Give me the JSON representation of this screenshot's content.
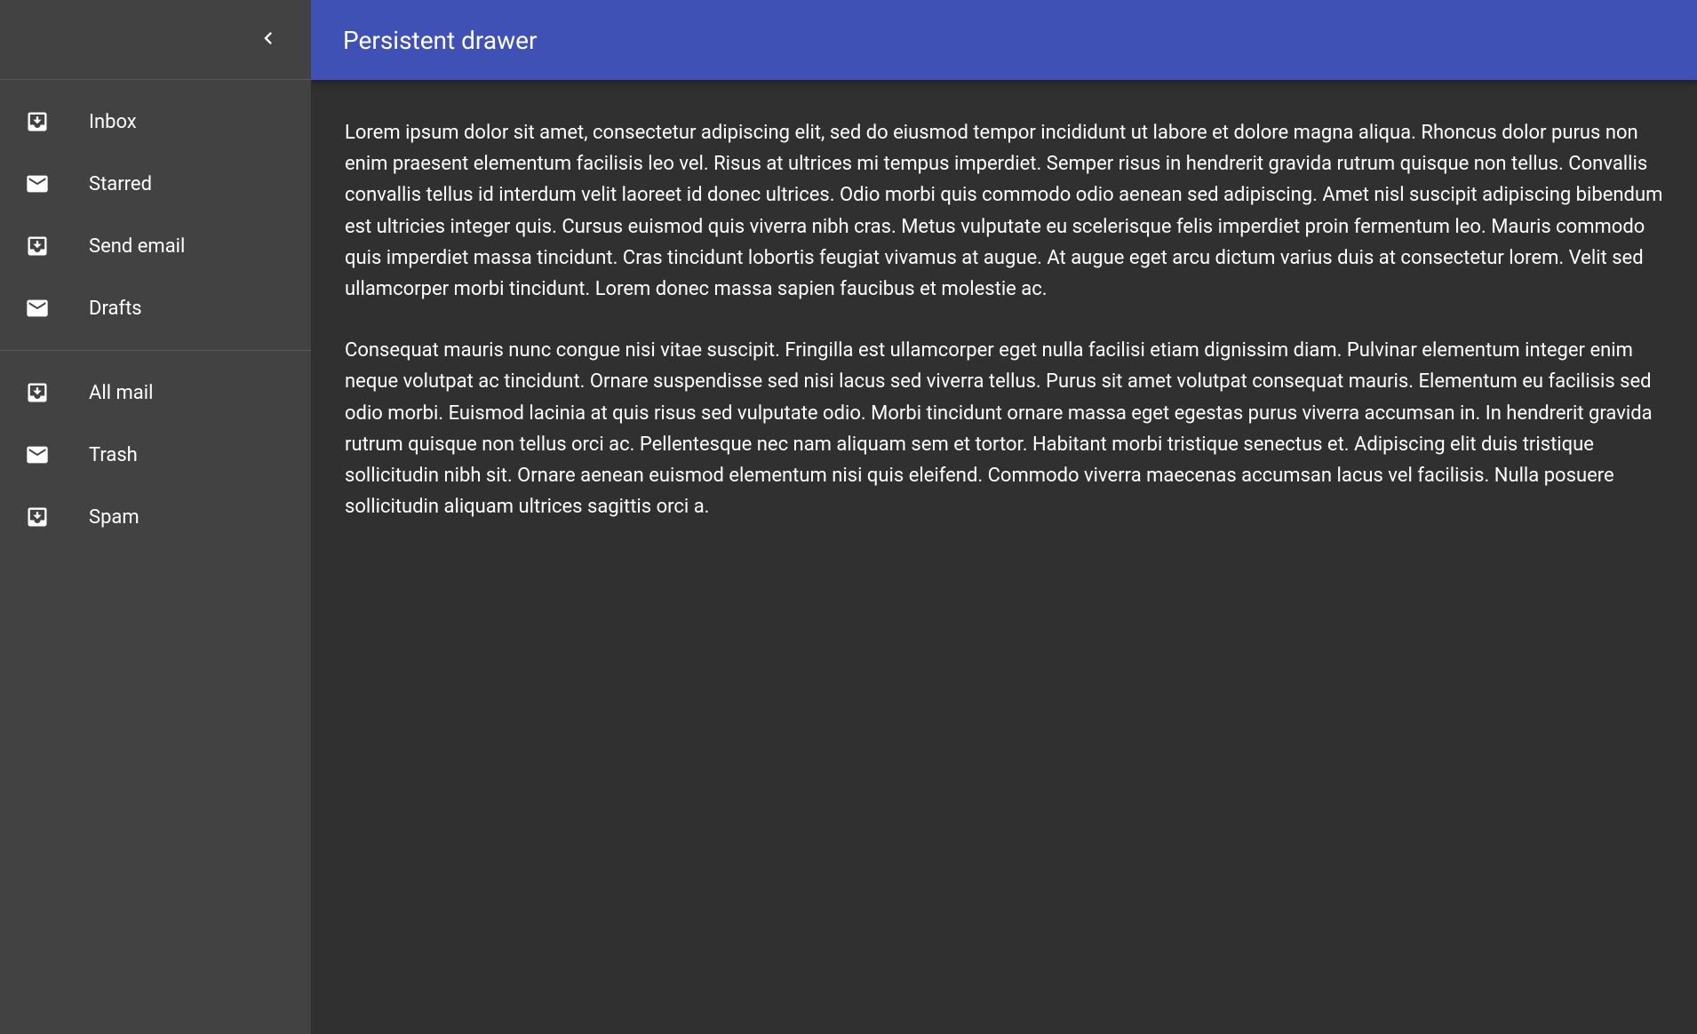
{
  "appbar": {
    "title": "Persistent drawer"
  },
  "drawer": {
    "group1": [
      {
        "label": "Inbox",
        "icon": "move-to-inbox"
      },
      {
        "label": "Starred",
        "icon": "mail"
      },
      {
        "label": "Send email",
        "icon": "move-to-inbox"
      },
      {
        "label": "Drafts",
        "icon": "mail"
      }
    ],
    "group2": [
      {
        "label": "All mail",
        "icon": "move-to-inbox"
      },
      {
        "label": "Trash",
        "icon": "mail"
      },
      {
        "label": "Spam",
        "icon": "move-to-inbox"
      }
    ]
  },
  "content": {
    "p1": "Lorem ipsum dolor sit amet, consectetur adipiscing elit, sed do eiusmod tempor incididunt ut labore et dolore magna aliqua. Rhoncus dolor purus non enim praesent elementum facilisis leo vel. Risus at ultrices mi tempus imperdiet. Semper risus in hendrerit gravida rutrum quisque non tellus. Convallis convallis tellus id interdum velit laoreet id donec ultrices. Odio morbi quis commodo odio aenean sed adipiscing. Amet nisl suscipit adipiscing bibendum est ultricies integer quis. Cursus euismod quis viverra nibh cras. Metus vulputate eu scelerisque felis imperdiet proin fermentum leo. Mauris commodo quis imperdiet massa tincidunt. Cras tincidunt lobortis feugiat vivamus at augue. At augue eget arcu dictum varius duis at consectetur lorem. Velit sed ullamcorper morbi tincidunt. Lorem donec massa sapien faucibus et molestie ac.",
    "p2": "Consequat mauris nunc congue nisi vitae suscipit. Fringilla est ullamcorper eget nulla facilisi etiam dignissim diam. Pulvinar elementum integer enim neque volutpat ac tincidunt. Ornare suspendisse sed nisi lacus sed viverra tellus. Purus sit amet volutpat consequat mauris. Elementum eu facilisis sed odio morbi. Euismod lacinia at quis risus sed vulputate odio. Morbi tincidunt ornare massa eget egestas purus viverra accumsan in. In hendrerit gravida rutrum quisque non tellus orci ac. Pellentesque nec nam aliquam sem et tortor. Habitant morbi tristique senectus et. Adipiscing elit duis tristique sollicitudin nibh sit. Ornare aenean euismod elementum nisi quis eleifend. Commodo viverra maecenas accumsan lacus vel facilisis. Nulla posuere sollicitudin aliquam ultrices sagittis orci a."
  }
}
